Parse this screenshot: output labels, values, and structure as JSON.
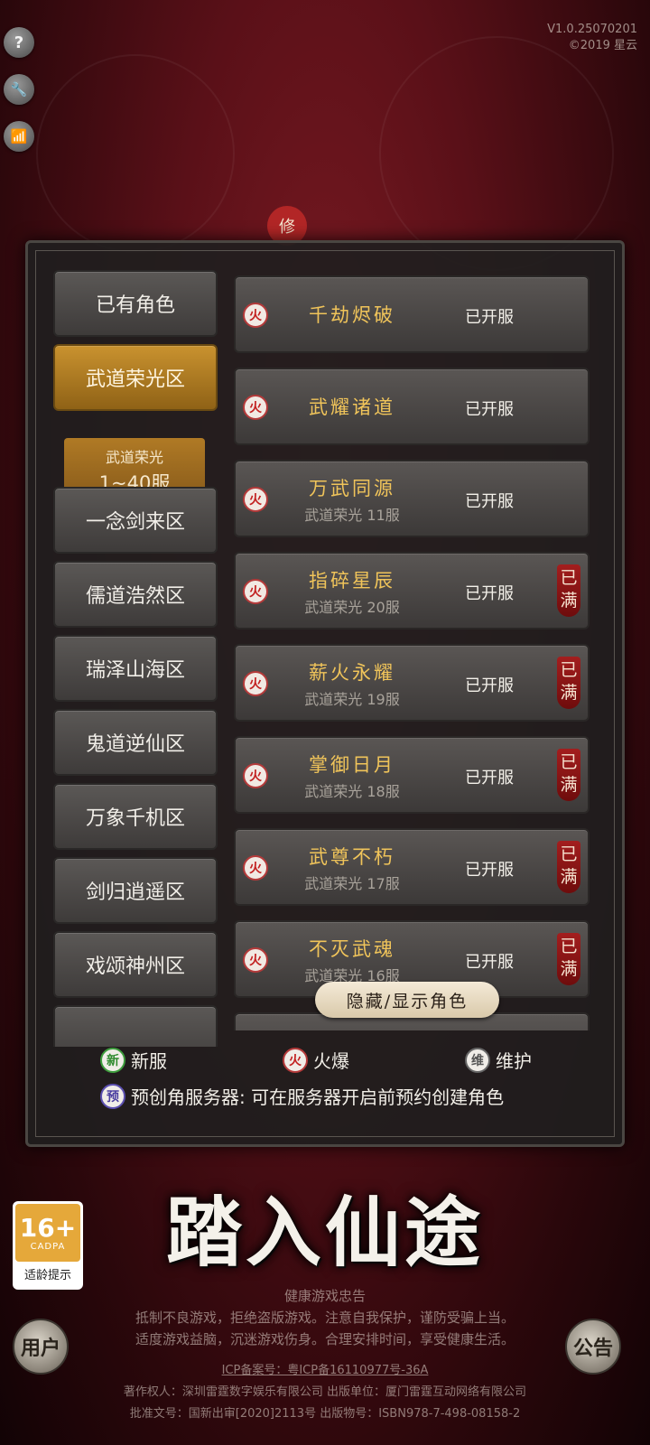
{
  "top_icons": {
    "help": "?",
    "settings": "🔧",
    "signal": "📶"
  },
  "version": {
    "line1": "V1.0.25070201",
    "line2": "©2019 星云"
  },
  "seal_char": "修",
  "sidebar": {
    "items": [
      {
        "label": "已有角色"
      },
      {
        "label": "武道荣光区"
      },
      {
        "label": "一念剑来区"
      },
      {
        "label": "儒道浩然区"
      },
      {
        "label": "瑞泽山海区"
      },
      {
        "label": "鬼道逆仙区"
      },
      {
        "label": "万象千机区"
      },
      {
        "label": "剑归逍遥区"
      },
      {
        "label": "戏颂神州区"
      }
    ],
    "active_sub": {
      "title": "武道荣光",
      "range": "1~40服"
    }
  },
  "servers": [
    {
      "name": "千劫烬破",
      "sub": "",
      "state": "已开服",
      "badge": "火",
      "full": ""
    },
    {
      "name": "武耀诸道",
      "sub": "",
      "state": "已开服",
      "badge": "火",
      "full": ""
    },
    {
      "name": "万武同源",
      "sub": "武道荣光 11服",
      "state": "已开服",
      "badge": "火",
      "full": ""
    },
    {
      "name": "指碎星辰",
      "sub": "武道荣光 20服",
      "state": "已开服",
      "badge": "火",
      "full": "已满"
    },
    {
      "name": "薪火永耀",
      "sub": "武道荣光 19服",
      "state": "已开服",
      "badge": "火",
      "full": "已满"
    },
    {
      "name": "掌御日月",
      "sub": "武道荣光 18服",
      "state": "已开服",
      "badge": "火",
      "full": "已满"
    },
    {
      "name": "武尊不朽",
      "sub": "武道荣光 17服",
      "state": "已开服",
      "badge": "火",
      "full": "已满"
    },
    {
      "name": "不灭武魂",
      "sub": "武道荣光 16服",
      "state": "已开服",
      "badge": "火",
      "full": "已满"
    }
  ],
  "toggle_roles": "隐藏/显示角色",
  "legend": {
    "new_badge": "新",
    "new_label": "新服",
    "hot_badge": "火",
    "hot_label": "火爆",
    "mnt_badge": "维",
    "mnt_label": "维护",
    "pre_badge": "预",
    "pre_label": "预创角服务器: 可在服务器开启前预约创建角色"
  },
  "enter_title": "踏入仙途",
  "age_rating": {
    "num": "16+",
    "org": "CADPA",
    "tip": "适龄提示"
  },
  "round_buttons": {
    "left": "用户",
    "right": "公告"
  },
  "health_notice": {
    "title": "健康游戏忠告",
    "line1": "抵制不良游戏，拒绝盗版游戏。注意自我保护，谨防受骗上当。",
    "line2": "适度游戏益脑，沉迷游戏伤身。合理安排时间，享受健康生活。",
    "icp": "ICP备案号：粤ICP备16110977号-36A",
    "copyright": "著作权人：深圳雷霆数字娱乐有限公司 出版单位：厦门雷霆互动网络有限公司",
    "approval": "批准文号：国新出审[2020]2113号 出版物号：ISBN978-7-498-08158-2"
  }
}
